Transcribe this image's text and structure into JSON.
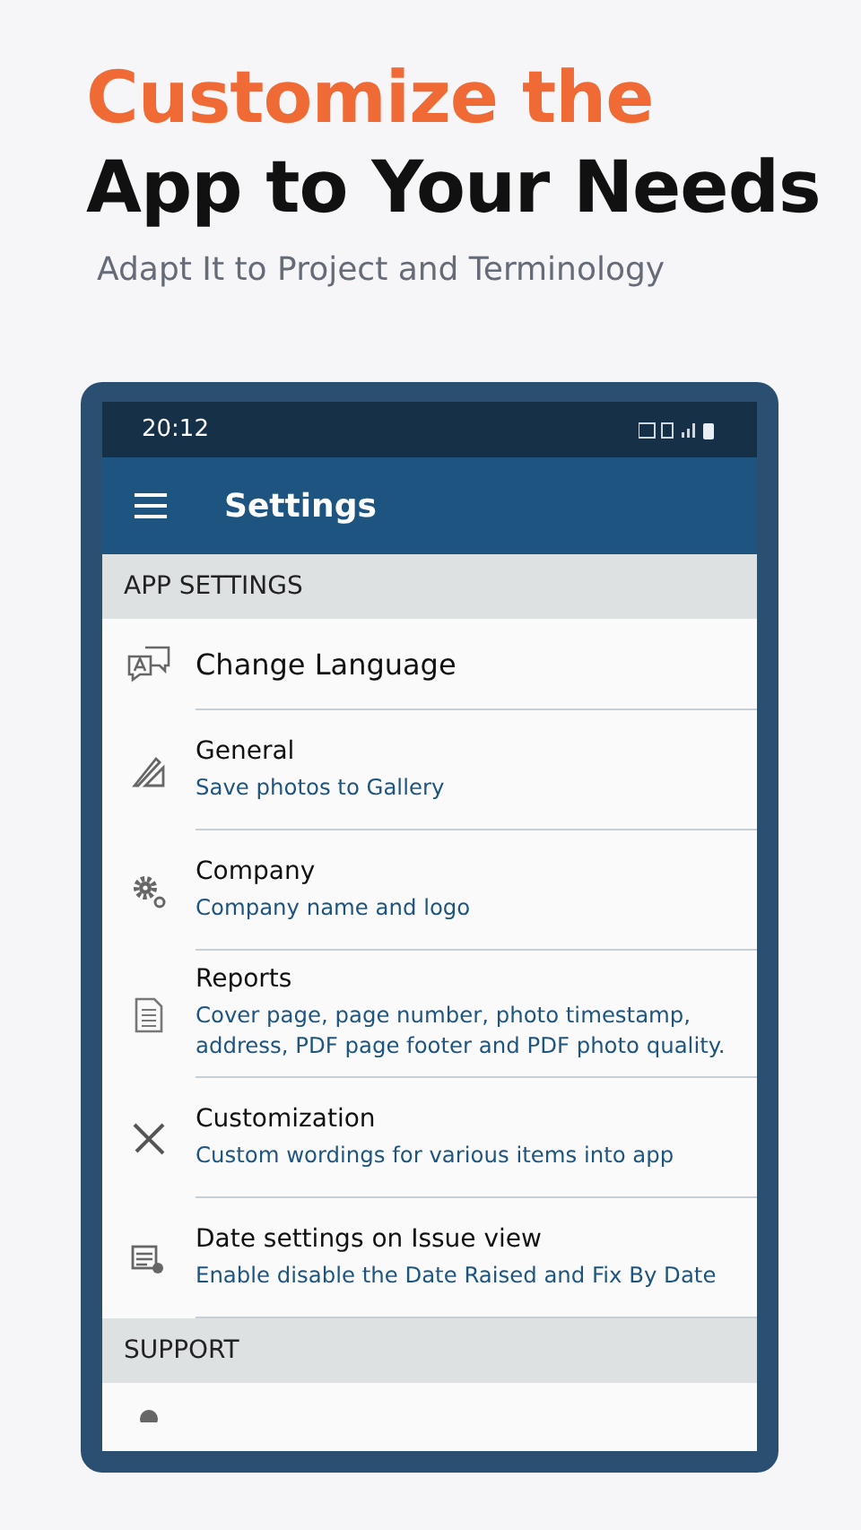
{
  "headline": {
    "line_1": "Customize the",
    "line_2": "App to Your Needs",
    "subtitle": "Adapt It to Project and Terminology"
  },
  "status_bar": {
    "time": "20:12"
  },
  "app_bar": {
    "title": "Settings"
  },
  "sections": [
    {
      "header": "APP SETTINGS",
      "items": [
        {
          "kind": "language",
          "title": "Change Language"
        },
        {
          "kind": "general",
          "title": "General",
          "subtitle": "Save photos to Gallery"
        },
        {
          "kind": "company",
          "title": "Company",
          "subtitle": "Company name and logo"
        },
        {
          "kind": "reports",
          "title": "Reports",
          "subtitle": "Cover page, page number, photo timestamp, address, PDF page footer and PDF photo quality."
        },
        {
          "kind": "customization",
          "title": "Customization",
          "subtitle": "Custom wordings for various items into app"
        },
        {
          "kind": "date",
          "title": "Date settings on Issue view",
          "subtitle": "Enable disable the Date Raised and Fix By Date"
        }
      ]
    },
    {
      "header": "SUPPORT",
      "items": [
        {
          "kind": "help"
        }
      ]
    }
  ]
}
